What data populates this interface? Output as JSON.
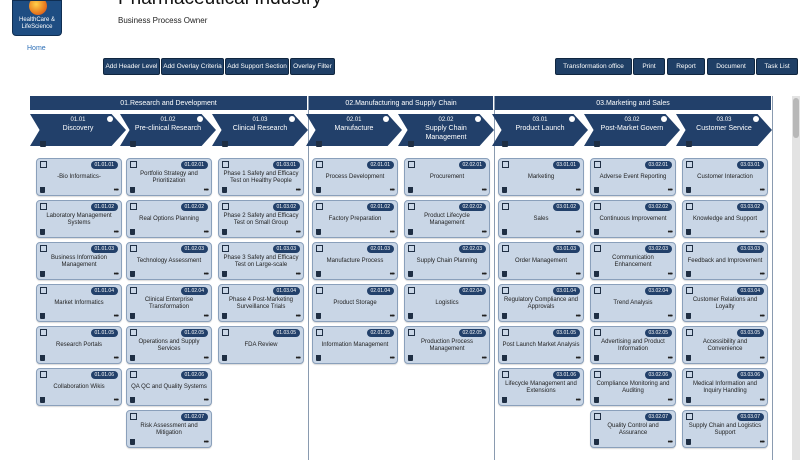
{
  "header": {
    "title": "Pharmaceutical Industry",
    "subtitle": "Business Process Owner",
    "logo_text": "HealthCare & LifeScience",
    "home": "Home"
  },
  "toolbar": {
    "left": [
      "Add Header Level",
      "Add Overlay Criteria",
      "Add Support Section",
      "Overlay Filter"
    ],
    "right": [
      "Transformation office",
      "Print",
      "Report",
      "Document",
      "Task List"
    ]
  },
  "sections": [
    {
      "title": "01.Research and Development"
    },
    {
      "title": "02.Manufacturing and Supply Chain"
    },
    {
      "title": "03.Marketing and Sales"
    }
  ],
  "columns": [
    {
      "code": "01.01",
      "name": "Discovery",
      "cards": [
        {
          "code": "01.01.01",
          "label": "-Bio Informatics-"
        },
        {
          "code": "01.01.02",
          "label": "Laboratory Management Systems"
        },
        {
          "code": "01.01.03",
          "label": "Business Information Management"
        },
        {
          "code": "01.01.04",
          "label": "Market Informatics"
        },
        {
          "code": "01.01.05",
          "label": "Research Portals"
        },
        {
          "code": "01.01.06",
          "label": "Collaboration Wikis"
        }
      ]
    },
    {
      "code": "01.02",
      "name": "Pre-clinical Research",
      "cards": [
        {
          "code": "01.02.01",
          "label": "Portfolio Strategy and Prioritization"
        },
        {
          "code": "01.02.02",
          "label": "Real Options Planning"
        },
        {
          "code": "01.02.03",
          "label": "Technology Assessment"
        },
        {
          "code": "01.02.04",
          "label": "Clinical Enterprise Transformation"
        },
        {
          "code": "01.02.05",
          "label": "Operations and Supply Services"
        },
        {
          "code": "01.02.06",
          "label": "QA QC and Quality Systems"
        },
        {
          "code": "01.02.07",
          "label": "Risk Assessment and Mitigation"
        }
      ]
    },
    {
      "code": "01.03",
      "name": "Clinical Research",
      "cards": [
        {
          "code": "01.03.01",
          "label": "Phase 1 Safety and Efficacy Test on Healthy People"
        },
        {
          "code": "01.03.02",
          "label": "Phase 2 Safety and Efficacy Test on Small Group"
        },
        {
          "code": "01.03.03",
          "label": "Phase 3 Safety and Efficacy Test on Large-scale"
        },
        {
          "code": "01.03.04",
          "label": "Phase 4 Post-Marketing Surveillance Trials"
        },
        {
          "code": "01.03.05",
          "label": "FDA Review"
        }
      ]
    },
    {
      "code": "02.01",
      "name": "Manufacture",
      "cards": [
        {
          "code": "02.01.01",
          "label": "Process Development"
        },
        {
          "code": "02.01.02",
          "label": "Factory Preparation"
        },
        {
          "code": "02.01.03",
          "label": "Manufacture Process"
        },
        {
          "code": "02.01.04",
          "label": "Product Storage"
        },
        {
          "code": "02.01.05",
          "label": "Information Management"
        }
      ]
    },
    {
      "code": "02.02",
      "name": "Supply Chain Management",
      "cards": [
        {
          "code": "02.02.01",
          "label": "Procurement"
        },
        {
          "code": "02.02.02",
          "label": "Product Lifecycle Management"
        },
        {
          "code": "02.02.03",
          "label": "Supply Chain Planning"
        },
        {
          "code": "02.02.04",
          "label": "Logistics"
        },
        {
          "code": "02.02.05",
          "label": "Production Process Management"
        }
      ]
    },
    {
      "code": "03.01",
      "name": "Product Launch",
      "cards": [
        {
          "code": "03.01.01",
          "label": "Marketing"
        },
        {
          "code": "03.01.02",
          "label": "Sales"
        },
        {
          "code": "03.01.03",
          "label": "Order Management"
        },
        {
          "code": "03.01.04",
          "label": "Regulatory Compliance and Approvals"
        },
        {
          "code": "03.01.05",
          "label": "Post Launch Market Analysis"
        },
        {
          "code": "03.01.06",
          "label": "Lifecycle Management and Extensions"
        }
      ]
    },
    {
      "code": "03.02",
      "name": "Post-Market Govern",
      "cards": [
        {
          "code": "03.02.01",
          "label": "Adverse Event Reporting"
        },
        {
          "code": "03.02.02",
          "label": "Continuous Improvement"
        },
        {
          "code": "03.02.03",
          "label": "Communication Enhancement"
        },
        {
          "code": "03.02.04",
          "label": "Trend Analysis"
        },
        {
          "code": "03.02.05",
          "label": "Advertising and Product Information"
        },
        {
          "code": "03.02.06",
          "label": "Compliance Monitoring and Auditing"
        },
        {
          "code": "03.02.07",
          "label": "Quality Control and Assurance"
        }
      ]
    },
    {
      "code": "03.03",
      "name": "Customer Service",
      "cards": [
        {
          "code": "03.03.01",
          "label": "Customer Interaction"
        },
        {
          "code": "03.03.02",
          "label": "Knowledge and Support"
        },
        {
          "code": "03.03.03",
          "label": "Feedback and Improvement"
        },
        {
          "code": "03.03.04",
          "label": "Customer Relations and Loyalty"
        },
        {
          "code": "03.03.05",
          "label": "Accessibility and Convenience"
        },
        {
          "code": "03.03.06",
          "label": "Medical Information and Inquiry Handling"
        },
        {
          "code": "03.03.07",
          "label": "Supply Chain and Logistics Support"
        }
      ]
    }
  ],
  "colors": {
    "primary": "#22406a",
    "card": "#c9d6e6"
  }
}
